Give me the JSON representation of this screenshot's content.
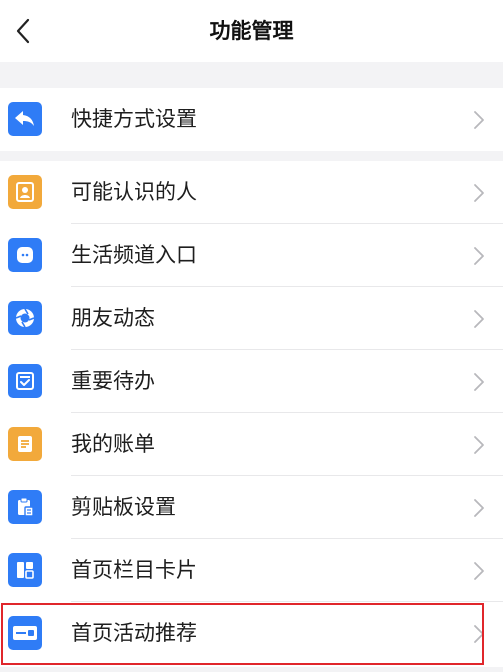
{
  "header": {
    "title": "功能管理"
  },
  "shortcut": {
    "label": "快捷方式设置",
    "icon": "reply-arrow-icon",
    "color": "#2f7cf6"
  },
  "items": [
    {
      "label": "可能认识的人",
      "icon": "contacts-book-icon",
      "color": "#f2a93b"
    },
    {
      "label": "生活频道入口",
      "icon": "chat-bubble-icon",
      "color": "#2f7cf6"
    },
    {
      "label": "朋友动态",
      "icon": "aperture-icon",
      "color": "#2f7cf6"
    },
    {
      "label": "重要待办",
      "icon": "todo-check-icon",
      "color": "#2f7cf6"
    },
    {
      "label": "我的账单",
      "icon": "bill-icon",
      "color": "#f2a93b"
    },
    {
      "label": "剪贴板设置",
      "icon": "clipboard-icon",
      "color": "#2f7cf6"
    },
    {
      "label": "首页栏目卡片",
      "icon": "layout-card-icon",
      "color": "#2f7cf6"
    },
    {
      "label": "首页活动推荐",
      "icon": "card-promo-icon",
      "color": "#2f7cf6"
    }
  ]
}
